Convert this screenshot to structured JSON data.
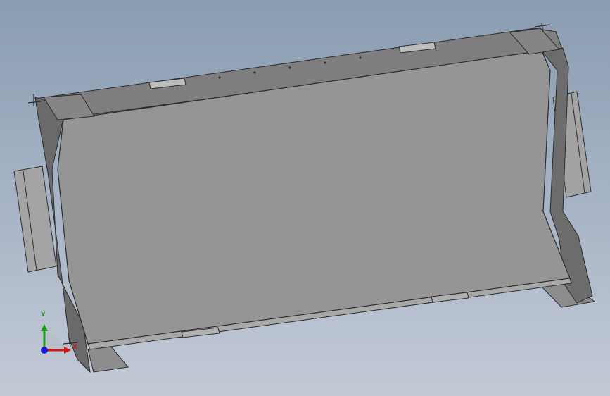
{
  "viewport": {
    "background_top": "#8a9cb1",
    "background_bottom": "#c3cad6",
    "model_face_color": "#959595",
    "model_edge_color": "#2b2b2b"
  },
  "triad": {
    "y_label": "Y",
    "x_label": "X",
    "y_color": "#1a9e1a",
    "x_color": "#d01818",
    "z_color": "#1a1ad0"
  }
}
